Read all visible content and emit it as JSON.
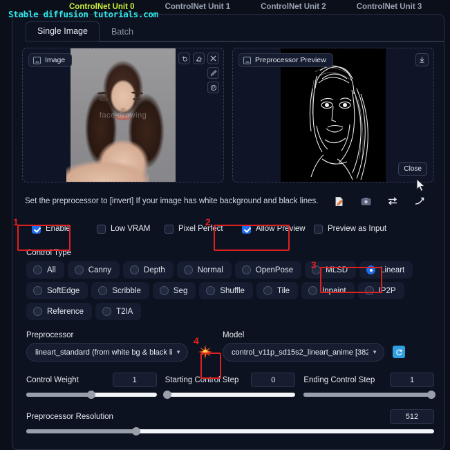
{
  "watermark": "Stable diffusion tutorials.com",
  "unit_tabs": [
    {
      "label": "ControlNet Unit 0",
      "active": true
    },
    {
      "label": "ControlNet Unit 1",
      "active": false
    },
    {
      "label": "ControlNet Unit 2",
      "active": false
    },
    {
      "label": "ControlNet Unit 3",
      "active": false
    }
  ],
  "inner_tabs": [
    {
      "label": "Single Image",
      "active": true
    },
    {
      "label": "Batch",
      "active": false
    }
  ],
  "image_panel": {
    "badge": "Image",
    "badge_icon": "image-icon",
    "watermark": "face drawing",
    "tools": [
      {
        "name": "undo-icon",
        "glyph": "↺"
      },
      {
        "name": "eraser-icon",
        "glyph": "✐"
      },
      {
        "name": "close-icon",
        "glyph": "✕"
      },
      {
        "name": "edit-pen-icon",
        "glyph": "✎"
      },
      {
        "name": "color-palette-icon",
        "glyph": "◐"
      }
    ]
  },
  "preview_panel": {
    "badge": "Preprocessor Preview",
    "badge_icon": "image-icon",
    "download_icon": "download-icon",
    "close_label": "Close"
  },
  "hint": {
    "text": "Set the preprocessor to [invert] If your image has white background and black lines.",
    "icons": [
      {
        "name": "edit-document-icon"
      },
      {
        "name": "camera-icon"
      },
      {
        "name": "swap-arrows-icon"
      },
      {
        "name": "send-arrow-icon"
      }
    ]
  },
  "checkboxes": [
    {
      "label": "Enable",
      "checked": true
    },
    {
      "label": "Low VRAM",
      "checked": false
    },
    {
      "label": "Pixel Perfect",
      "checked": false
    },
    {
      "label": "Allow Preview",
      "checked": true
    },
    {
      "label": "Preview as Input",
      "checked": false
    }
  ],
  "control_type": {
    "label": "Control Type",
    "options": [
      {
        "label": "All",
        "selected": false
      },
      {
        "label": "Canny",
        "selected": false
      },
      {
        "label": "Depth",
        "selected": false
      },
      {
        "label": "Normal",
        "selected": false
      },
      {
        "label": "OpenPose",
        "selected": false
      },
      {
        "label": "MLSD",
        "selected": false
      },
      {
        "label": "Lineart",
        "selected": true
      },
      {
        "label": "SoftEdge",
        "selected": false
      },
      {
        "label": "Scribble",
        "selected": false
      },
      {
        "label": "Seg",
        "selected": false
      },
      {
        "label": "Shuffle",
        "selected": false
      },
      {
        "label": "Tile",
        "selected": false
      },
      {
        "label": "Inpaint",
        "selected": false
      },
      {
        "label": "IP2P",
        "selected": false
      },
      {
        "label": "Reference",
        "selected": false
      },
      {
        "label": "T2IA",
        "selected": false
      }
    ]
  },
  "preprocessor": {
    "label": "Preprocessor",
    "value": "lineart_standard (from white bg & black lin"
  },
  "run_button": {
    "name": "run-preprocessor-burst"
  },
  "model": {
    "label": "Model",
    "value": "control_v11p_sd15s2_lineart_anime [382",
    "refresh_icon": "refresh-icon"
  },
  "sliders": [
    {
      "label": "Control Weight",
      "value": "1",
      "pct": 50
    },
    {
      "label": "Starting Control Step",
      "value": "0",
      "pct": 2
    },
    {
      "label": "Ending Control Step",
      "value": "1",
      "pct": 98
    }
  ],
  "resolution": {
    "label": "Preprocessor Resolution",
    "value": "512",
    "pct": 27
  },
  "annotations": [
    {
      "num": "1"
    },
    {
      "num": "2"
    },
    {
      "num": "3"
    },
    {
      "num": "4"
    }
  ],
  "colors": {
    "accent_blue": "#1f6feb",
    "annotation_red": "#e02020",
    "active_tab": "#c8ef3a",
    "watermark_cyan": "#2fe8e8"
  }
}
